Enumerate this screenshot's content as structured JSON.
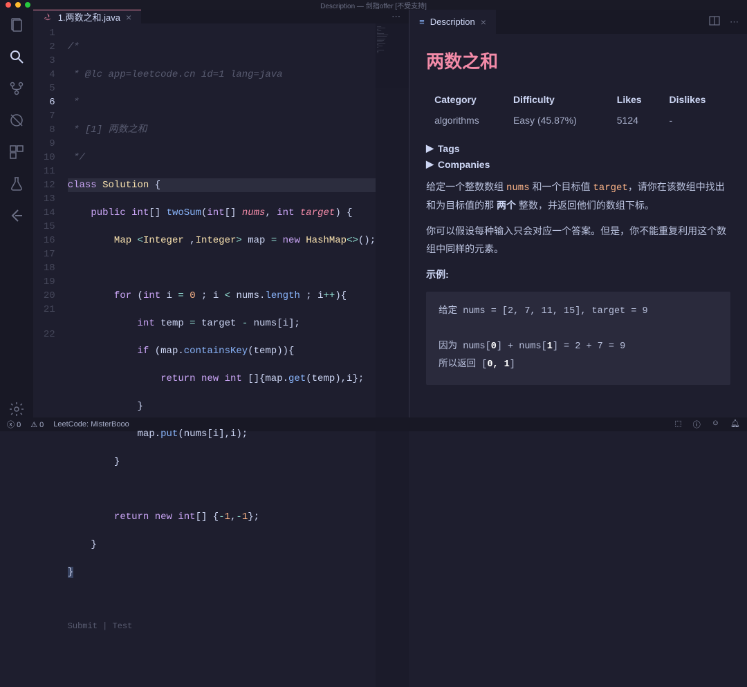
{
  "window": {
    "title": "Description — 剑指offer [不受支持]"
  },
  "tabs": {
    "editor": {
      "label": "1.两数之和.java"
    },
    "description": {
      "label": "Description"
    }
  },
  "codeLens": {
    "text": "Submit | Test"
  },
  "code": {
    "lines": [
      "/*",
      " * @lc app=leetcode.cn id=1 lang=java",
      " *",
      " * [1] 两数之和",
      " */",
      "class Solution {",
      "    public int[] twoSum(int[] nums, int target) {",
      "        Map <Integer ,Integer> map = new HashMap<>();",
      "",
      "        for (int i = 0 ; i < nums.length ; i++){",
      "            int temp = target - nums[i];",
      "            if (map.containsKey(temp)){",
      "                return new int []{map.get(temp),i};",
      "            }",
      "            map.put(nums[i],i);",
      "        }",
      "",
      "        return new int[] {-1,-1};",
      "    }",
      "}",
      "",
      ""
    ]
  },
  "description": {
    "title": "两数之和",
    "headers": {
      "category": "Category",
      "difficulty": "Difficulty",
      "likes": "Likes",
      "dislikes": "Dislikes"
    },
    "values": {
      "category": "algorithms",
      "difficulty": "Easy (45.87%)",
      "likes": "5124",
      "dislikes": "-"
    },
    "sections": {
      "tags": "Tags",
      "companies": "Companies"
    },
    "para1_pre": "给定一个整数数组 ",
    "para1_code1": "nums",
    "para1_mid": " 和一个目标值 ",
    "para1_code2": "target",
    "para1_after": "，请你在该数组中找出和为目标值的那 ",
    "para1_bold": "两个",
    "para1_end": " 整数，并返回他们的数组下标。",
    "para2": "你可以假设每种输入只会对应一个答案。但是，你不能重复利用这个数组中同样的元素。",
    "example_label": "示例:",
    "example_line1_a": "给定 nums = [2, 7, 11, 15], target = 9",
    "example_line2_a": "因为 nums[",
    "example_line2_b": "0",
    "example_line2_c": "] + nums[",
    "example_line2_d": "1",
    "example_line2_e": "] = 2 + 7 = 9",
    "example_line3_a": "所以返回 [",
    "example_line3_b": "0, 1",
    "example_line3_c": "]"
  },
  "status": {
    "errors": "0",
    "warnings": "0",
    "leetcode": "LeetCode: MisterBooo"
  }
}
